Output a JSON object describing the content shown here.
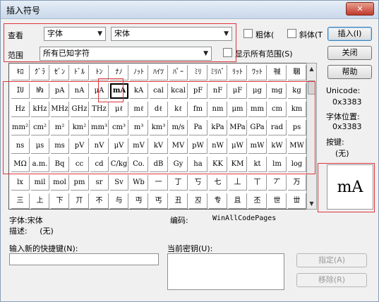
{
  "window": {
    "title": "插入符号",
    "close_glyph": "✕"
  },
  "font_row": {
    "label": "查看",
    "view_value": "字体",
    "font_value": "宋体",
    "bold_label": "粗体",
    "bold_paren": "(",
    "italic_label": "斜体",
    "italic_paren": "(T"
  },
  "range_row": {
    "label": "范围",
    "range_value": "所有已知字符",
    "show_all_label": "显示所有范围(S)"
  },
  "buttons": {
    "insert": "插入(I)",
    "close": "关闭",
    "help": "帮助",
    "assign": "指定(A)",
    "remove": "移除(R)"
  },
  "info": {
    "unicode_label": "Unicode:",
    "unicode_value": "0x3383",
    "position_label": "字体位置:",
    "position_value": "0x3383",
    "key_label": "按键:",
    "key_value": "(无)",
    "preview_glyph": "mA"
  },
  "status": {
    "font_label": "字体:",
    "font_value": "宋体",
    "desc_label": "描述:",
    "desc_value": "(无)",
    "encoding_label": "编码:",
    "encoding_value": "WinAllCodePages"
  },
  "shortcut": {
    "new_key_label": "输入新的快捷键(N):",
    "current_key_label": "当前密钥(U):"
  },
  "grid": {
    "selected_index": 5,
    "rows": [
      [
        "ｷﾛ",
        "ｸﾞﾗ",
        "ｾﾞﾝ",
        "ﾄﾞﾙ",
        "ﾄﾝ",
        "ﾅﾉ",
        "ﾉｯﾄ",
        "ﾊｲﾂ",
        "ﾊﾟｰ",
        "ﾐﾘ",
        "ﾐﾘﾊﾞ",
        "ﾘｯﾄ",
        "ﾜｯﾄ",
        "㍻",
        "㍼"
      ],
      [
        "㍺",
        "㍱",
        "pA",
        "nA",
        "μA",
        "mA",
        "kA",
        "cal",
        "kcal",
        "pF",
        "nF",
        "μF",
        "μg",
        "mg",
        "kg"
      ],
      [
        "Hz",
        "kHz",
        "MHz",
        "GHz",
        "THz",
        "μℓ",
        "mℓ",
        "dℓ",
        "kℓ",
        "fm",
        "nm",
        "μm",
        "mm",
        "cm",
        "km"
      ],
      [
        "mm²",
        "cm²",
        "m²",
        "km²",
        "mm³",
        "cm³",
        "m³",
        "km³",
        "m/s",
        "Pa",
        "kPa",
        "MPa",
        "GPa",
        "rad",
        "ps"
      ],
      [
        "ns",
        "μs",
        "ms",
        "pV",
        "nV",
        "μV",
        "mV",
        "kV",
        "MV",
        "pW",
        "nW",
        "μW",
        "mW",
        "kW",
        "MW"
      ],
      [
        "MΩ",
        "a.m.",
        "Bq",
        "cc",
        "cd",
        "C/kg",
        "Co.",
        "dB",
        "Gy",
        "ha",
        "KK",
        "KM",
        "kt",
        "lm",
        "log"
      ],
      [
        "lx",
        "mil",
        "mol",
        "pm",
        "sr",
        "Sv",
        "Wb",
        "一",
        "丁",
        "丂",
        "七",
        "丄",
        "丅",
        "丆",
        "万"
      ],
      [
        "三",
        "上",
        "下",
        "丌",
        "不",
        "与",
        "丏",
        "丐",
        "丑",
        "丒",
        "专",
        "且",
        "丕",
        "世",
        "丗"
      ]
    ]
  }
}
